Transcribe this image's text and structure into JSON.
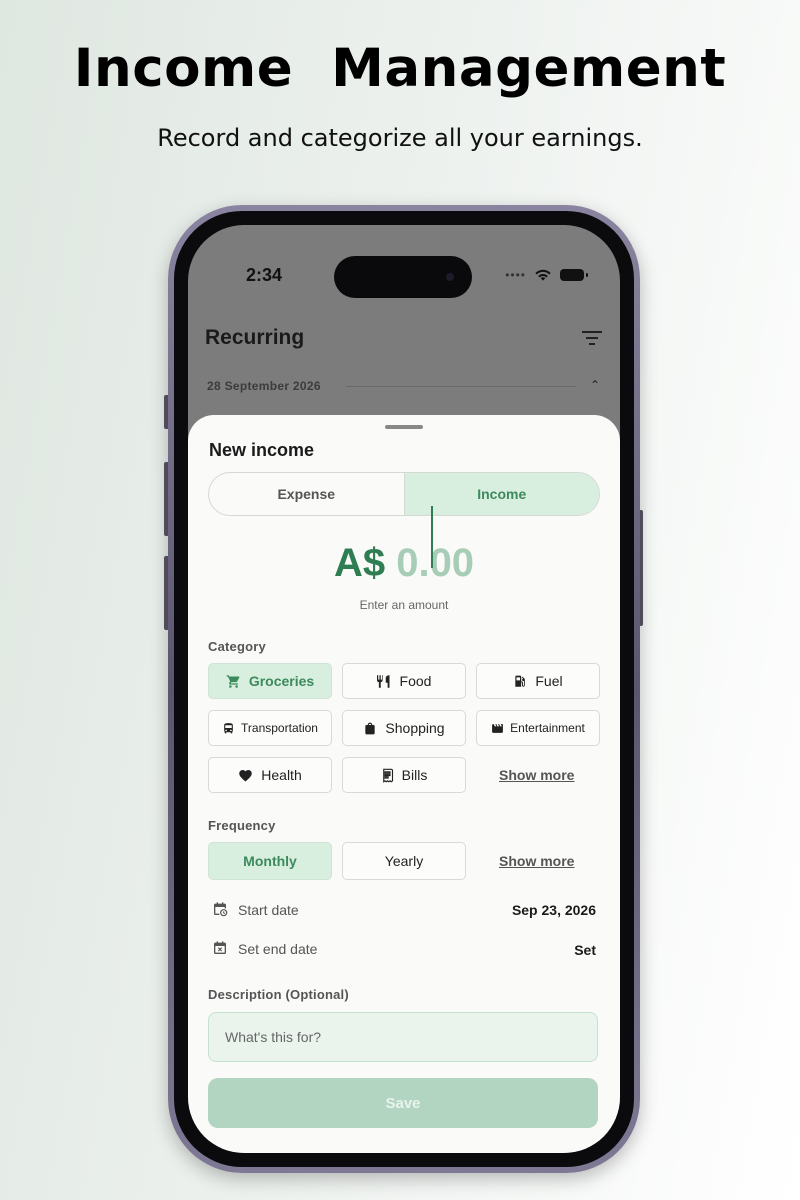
{
  "hero": {
    "title": "Income  Management",
    "subtitle": "Record and categorize all your earnings."
  },
  "status_bar": {
    "time": "2:34",
    "signal": "••••"
  },
  "background_screen": {
    "title": "Recurring",
    "date_header": "28 September 2026"
  },
  "sheet": {
    "title": "New income",
    "type_toggle": {
      "options": [
        "Expense",
        "Income"
      ],
      "selected": "Income"
    },
    "amount": {
      "currency": "A$",
      "value": "0.00",
      "hint": "Enter an amount"
    },
    "category": {
      "label": "Category",
      "options": [
        {
          "label": "Groceries",
          "icon": "cart-icon",
          "selected": true
        },
        {
          "label": "Food",
          "icon": "cutlery-icon",
          "selected": false
        },
        {
          "label": "Fuel",
          "icon": "fuel-icon",
          "selected": false
        },
        {
          "label": "Transportation",
          "icon": "bus-icon",
          "selected": false
        },
        {
          "label": "Shopping",
          "icon": "shopping-bag-icon",
          "selected": false
        },
        {
          "label": "Entertainment",
          "icon": "clapperboard-icon",
          "selected": false
        },
        {
          "label": "Health",
          "icon": "heart-icon",
          "selected": false
        },
        {
          "label": "Bills",
          "icon": "receipt-icon",
          "selected": false
        }
      ],
      "show_more": "Show more"
    },
    "frequency": {
      "label": "Frequency",
      "options": [
        {
          "label": "Monthly",
          "selected": true
        },
        {
          "label": "Yearly",
          "selected": false
        }
      ],
      "show_more": "Show more"
    },
    "start_date": {
      "label": "Start date",
      "value": "Sep 23, 2026"
    },
    "end_date": {
      "label": "Set end date",
      "value": "Set"
    },
    "description": {
      "label": "Description (Optional)",
      "placeholder": "What's this for?",
      "value": ""
    },
    "save_label": "Save"
  },
  "colors": {
    "accent": "#2f7d52",
    "accent_light": "#d8eedf",
    "save_disabled": "#b1d5c1"
  }
}
